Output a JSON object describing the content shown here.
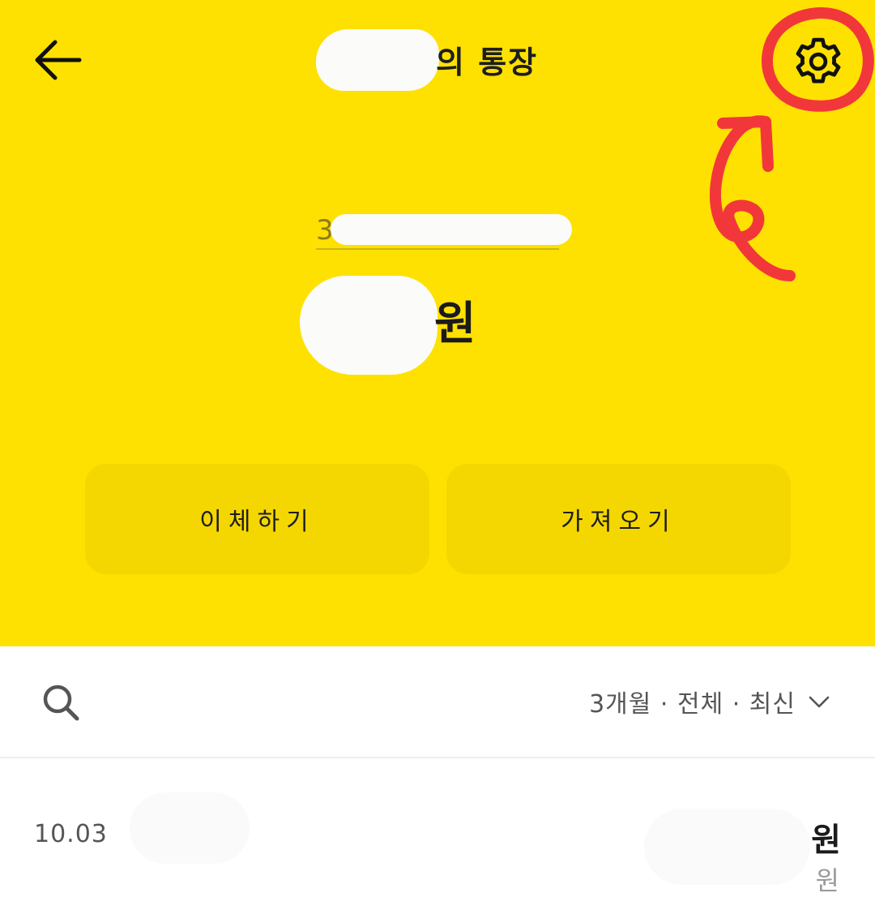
{
  "header": {
    "title_suffix": "의 통장",
    "back_icon": "arrow-left-icon",
    "settings_icon": "gear-icon"
  },
  "account": {
    "number_visible_prefix": "3",
    "balance_unit": "원"
  },
  "actions": {
    "transfer_label": "이체하기",
    "fetch_label": "가져오기"
  },
  "filter": {
    "search_icon": "search-icon",
    "label": "3개월 · 전체 · 최신",
    "chevron_icon": "chevron-down-icon"
  },
  "transactions": [
    {
      "date": "10.03",
      "amount_unit": "원",
      "balance_unit": "원"
    }
  ],
  "colors": {
    "brand_yellow": "#FEE100",
    "button_yellow": "#F4D700",
    "annotation_red": "#F2373B"
  }
}
